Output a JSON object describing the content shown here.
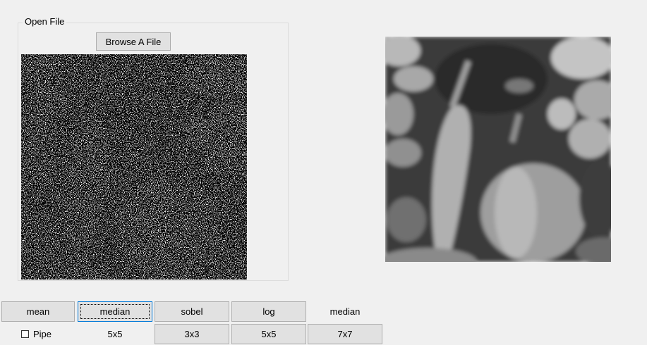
{
  "open_file_group": {
    "title": "Open File",
    "browse_label": "Browse A File"
  },
  "images": {
    "input": "noisy-peppers-image",
    "output": "filtered-peppers-image"
  },
  "filter_buttons": {
    "mean": "mean",
    "median": "median",
    "sobel": "sobel",
    "log": "log"
  },
  "current_filter_label": "median",
  "pipe_checkbox": {
    "label": "Pipe",
    "checked": false
  },
  "kernel": {
    "selected_label": "5x5",
    "btn_3x3": "3x3",
    "btn_5x5": "5x5",
    "btn_7x7": "7x7"
  }
}
